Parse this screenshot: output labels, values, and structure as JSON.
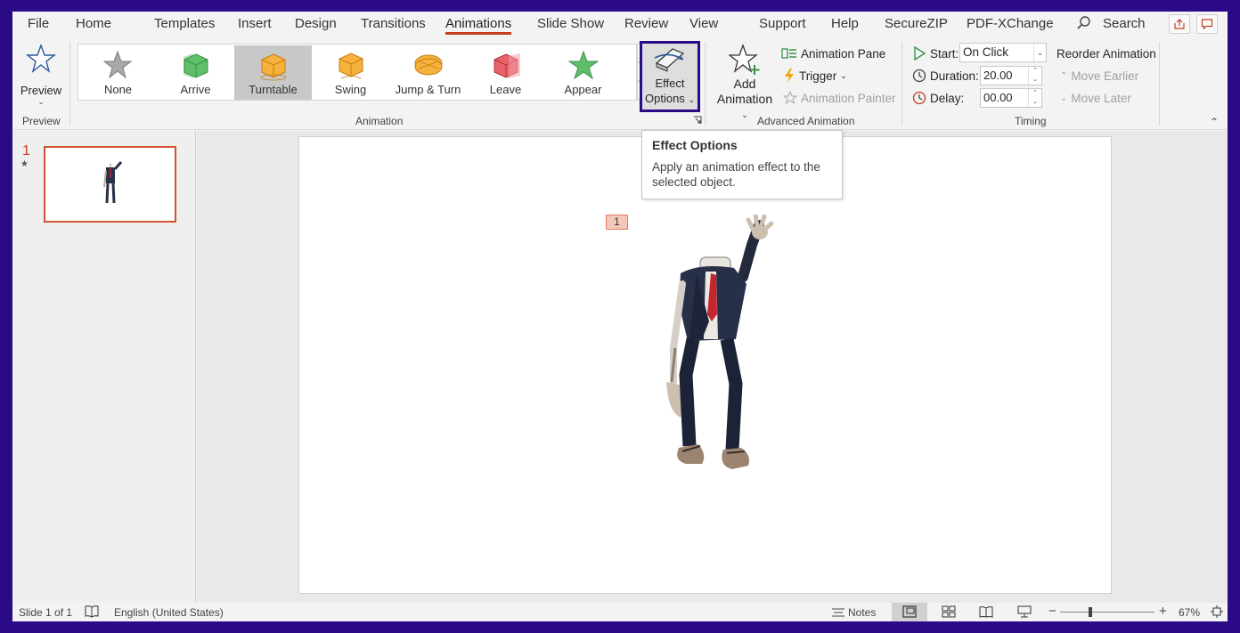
{
  "menu": {
    "items": [
      "File",
      "Home",
      "Templates",
      "Insert",
      "Design",
      "Transitions",
      "Animations",
      "Slide Show",
      "Review",
      "View",
      "Support",
      "Help",
      "SecureZIP",
      "PDF-XChange"
    ],
    "active": "Animations",
    "search_label": "Search"
  },
  "ribbon": {
    "preview": {
      "label": "Preview",
      "group": "Preview"
    },
    "animation_group": "Animation",
    "gallery": [
      {
        "label": "None",
        "icon": "star-gray-icon"
      },
      {
        "label": "Arrive",
        "icon": "cube-green-icon"
      },
      {
        "label": "Turntable",
        "icon": "cube-orange-icon",
        "selected": true
      },
      {
        "label": "Swing",
        "icon": "cube-orange-icon"
      },
      {
        "label": "Jump & Turn",
        "icon": "disc-orange-icon"
      },
      {
        "label": "Leave",
        "icon": "cube-red-icon"
      },
      {
        "label": "Appear",
        "icon": "star-green-icon"
      }
    ],
    "effect_options": {
      "line1": "Effect",
      "line2": "Options"
    },
    "advanced": {
      "group": "Advanced Animation",
      "add_line1": "Add",
      "add_line2": "Animation",
      "pane": "Animation Pane",
      "trigger": "Trigger",
      "painter": "Animation Painter"
    },
    "timing": {
      "group": "Timing",
      "start_label": "Start:",
      "start_value": "On Click",
      "duration_label": "Duration:",
      "duration_value": "20.00",
      "delay_label": "Delay:",
      "delay_value": "00.00",
      "reorder": "Reorder Animation",
      "move_earlier": "Move Earlier",
      "move_later": "Move Later"
    }
  },
  "tooltip": {
    "title": "Effect Options",
    "body": "Apply an animation effect to the selected object."
  },
  "thumbnails": {
    "number": "1",
    "star": "★"
  },
  "slide": {
    "anim_tag": "1"
  },
  "status": {
    "slide_info": "Slide 1 of 1",
    "language": "English (United States)",
    "notes": "Notes",
    "zoom": "67%"
  },
  "colors": {
    "accent": "#c43e1c",
    "frame": "#2a0a86"
  }
}
